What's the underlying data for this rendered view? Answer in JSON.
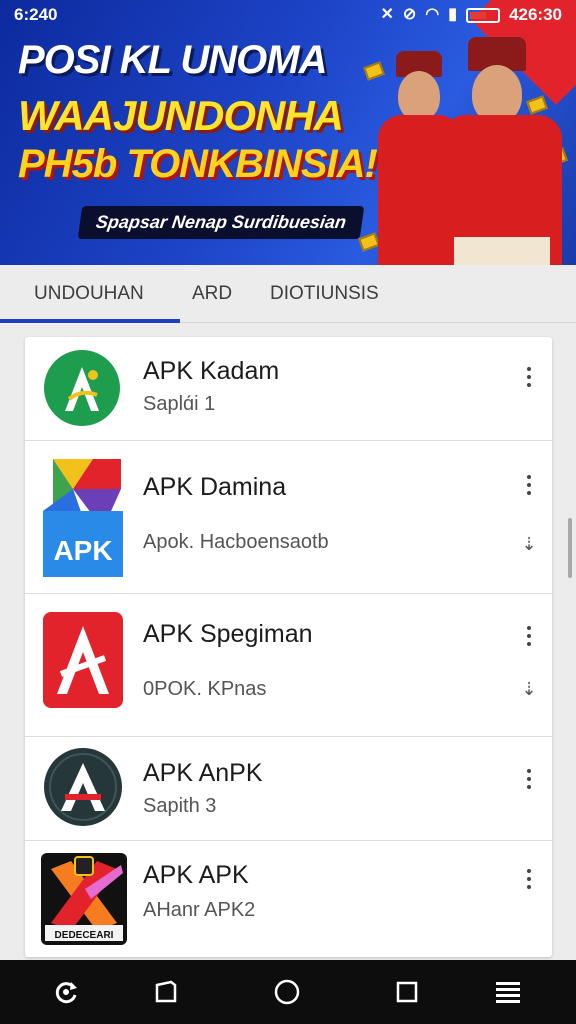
{
  "status_bar": {
    "time": "6:240",
    "right_text": "426:30"
  },
  "banner": {
    "line1": "POSI KL UNOMA",
    "line2": "WAAJUNDONHA",
    "line3": "PH5b TONKBINSIA!",
    "subtitle": "Spapsar Nenap Surdibuesian"
  },
  "tabs": [
    {
      "label": "UNDOUHAN",
      "active": true
    },
    {
      "label": "ARD",
      "active": false
    },
    {
      "label": "DIOTIUNSIS",
      "active": false
    }
  ],
  "apps": [
    {
      "title": "APK Kadam",
      "subtitle": "Saplɑ́i 1",
      "icon": "green-circle-a-icon",
      "download": false
    },
    {
      "title": "APK Damina",
      "subtitle": "Apok. Hacboensaotb",
      "icon": "apk-tile-icon",
      "download": true
    },
    {
      "title": "APK Spegiman",
      "subtitle": "0POK. KPnas",
      "icon": "red-a-icon",
      "download": true
    },
    {
      "title": "APK AnPK",
      "subtitle": "Sapith 3",
      "icon": "dark-circle-a-icon",
      "download": false
    },
    {
      "title": "APK APK",
      "subtitle": "AHanr APK2",
      "icon": "colorful-x-icon",
      "download": false
    }
  ],
  "app5_icon_label": "DEDECEARI",
  "apk_tile_label": "APK",
  "colors": {
    "accent": "#1a3fc0",
    "banner_bg": "#1d44c7",
    "nav_bg": "#0d0d0d"
  },
  "nav": [
    "recent-rotate-icon",
    "back-square-icon",
    "home-circle-icon",
    "overview-square-icon",
    "menu-lines-icon"
  ]
}
